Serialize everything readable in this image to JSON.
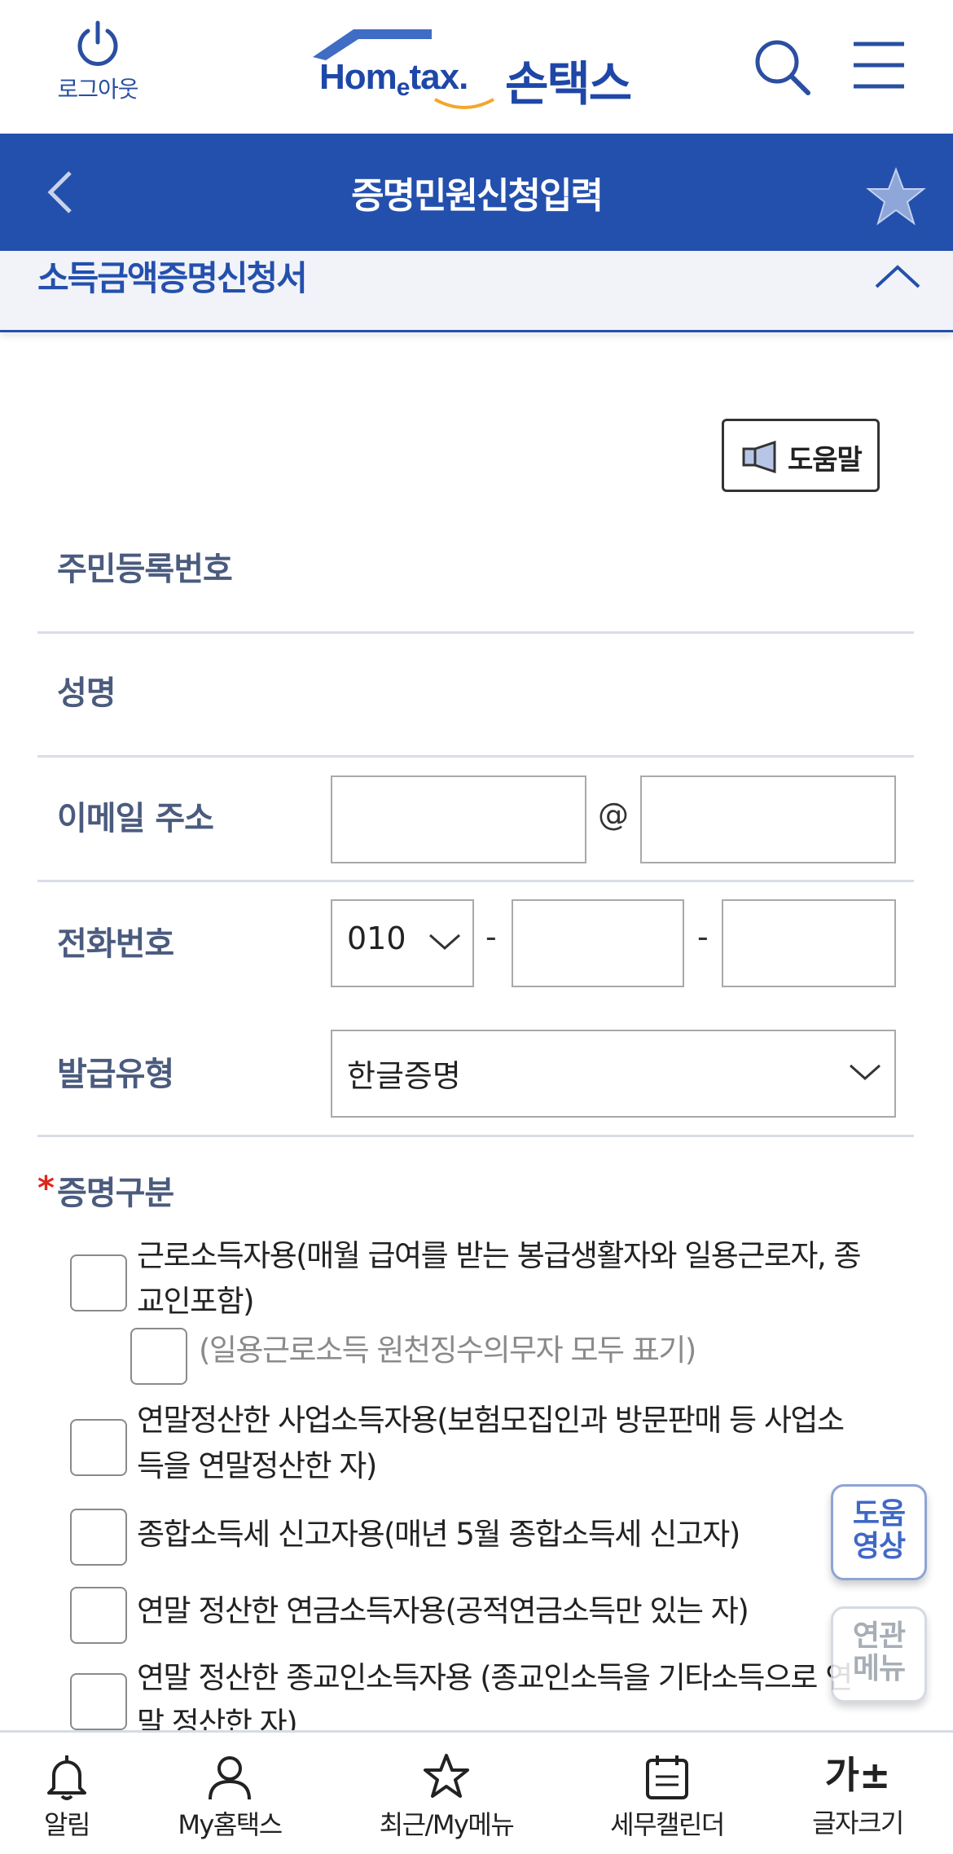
{
  "header": {
    "logout_label": "로그아웃",
    "logo_home": "Hom",
    "logo_e": "e",
    "logo_tax": "tax.",
    "logo_kr": "손택스",
    "brand_color": "#1e47a8"
  },
  "titlebar": {
    "title": "증명민원신청입력",
    "bg_color": "#2450ad"
  },
  "section": {
    "title": "소득금액증명신청서"
  },
  "help_button": {
    "label": "도움말"
  },
  "form": {
    "resident_number_label": "주민등록번호",
    "name_label": "성명",
    "email_label": "이메일 주소",
    "email_at": "@",
    "email_local_value": "",
    "email_domain_value": "",
    "phone_label": "전화번호",
    "phone_prefix": "010",
    "phone_dash": "-",
    "phone_middle_value": "",
    "phone_last_value": "",
    "issue_type_label": "발급유형",
    "issue_type_value": "한글증명",
    "cert_type_required_mark": "*",
    "cert_type_label": "증명구분"
  },
  "options": [
    {
      "line1": "근로소득자용(매월 급여를 받는 봉급생활자와 일용근로자, 종",
      "line2": "교인포함)"
    },
    {
      "line1": "(일용근로소득 원천징수의무자 모두 표기)"
    },
    {
      "line1": "연말정산한 사업소득자용(보험모집인과 방문판매 등 사업소",
      "line2": "득을 연말정산한 자)"
    },
    {
      "line1": "종합소득세 신고자용(매년 5월 종합소득세 신고자)"
    },
    {
      "line1": "연말 정산한 연금소득자용(공적연금소득만 있는 자)"
    },
    {
      "line1": "연말 정산한 종교인소득자용 (종교인소득을 기타소득으로 연",
      "line2": "말 정산한 자)"
    }
  ],
  "floating": {
    "video_help_line1": "도움",
    "video_help_line2": "영상",
    "related_menu_line1": "연관",
    "related_menu_line2": "메뉴"
  },
  "bottom_nav": {
    "alert": "알림",
    "my_hometax": "My홈택스",
    "recent_menu": "최근/My메뉴",
    "tax_calendar": "세무캘린더",
    "font_size": "글자크기",
    "font_size_icon_text": "가±"
  }
}
